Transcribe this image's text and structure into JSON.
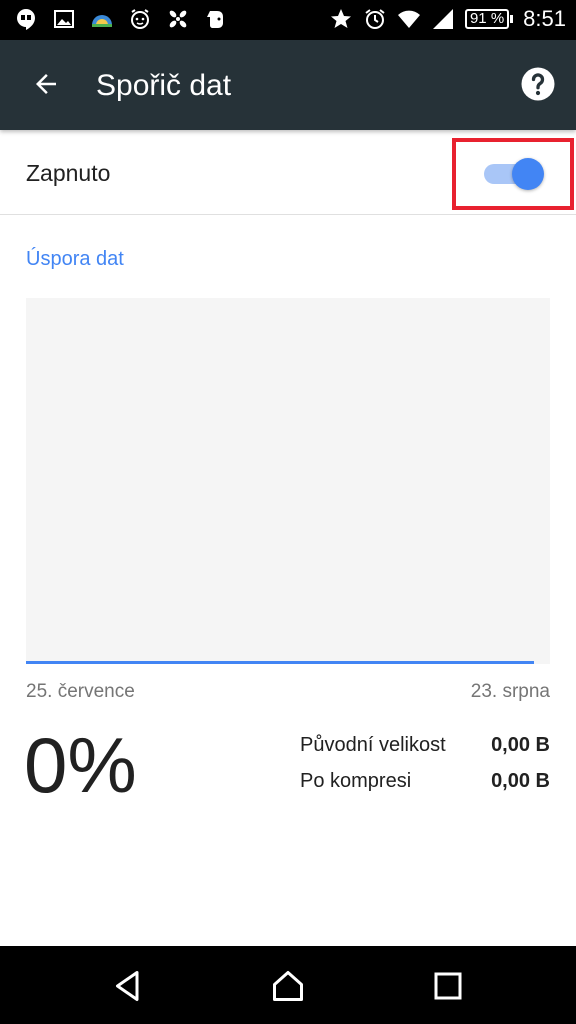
{
  "status_bar": {
    "left_icons": [
      "hangouts-icon",
      "image-icon",
      "weather-icon",
      "alarm-clock-app-icon",
      "pinwheel-icon",
      "evernote-icon"
    ],
    "right_icons": [
      "star-icon",
      "alarm-icon",
      "wifi-icon",
      "cellular-signal-icon"
    ],
    "battery": "91 %",
    "time": "8:51"
  },
  "toolbar": {
    "title": "Spořič dat",
    "back_icon": "arrow-back-icon",
    "help_icon": "help-icon"
  },
  "data_saver": {
    "toggle_label": "Zapnuto",
    "toggle_on": true
  },
  "savings": {
    "section_header": "Úspora dat",
    "date_start": "25. července",
    "date_end": "23. srpna",
    "percent": "0%",
    "original_size_label": "Původní velikost",
    "original_size_value": "0,00 B",
    "compressed_label": "Po kompresi",
    "compressed_value": "0,00 B"
  },
  "colors": {
    "accent": "#4285f4",
    "toolbar": "#263238",
    "highlight": "#e8212f"
  },
  "nav_bar": {
    "back_icon": "nav-back-icon",
    "home_icon": "nav-home-icon",
    "recents_icon": "nav-recents-icon"
  }
}
